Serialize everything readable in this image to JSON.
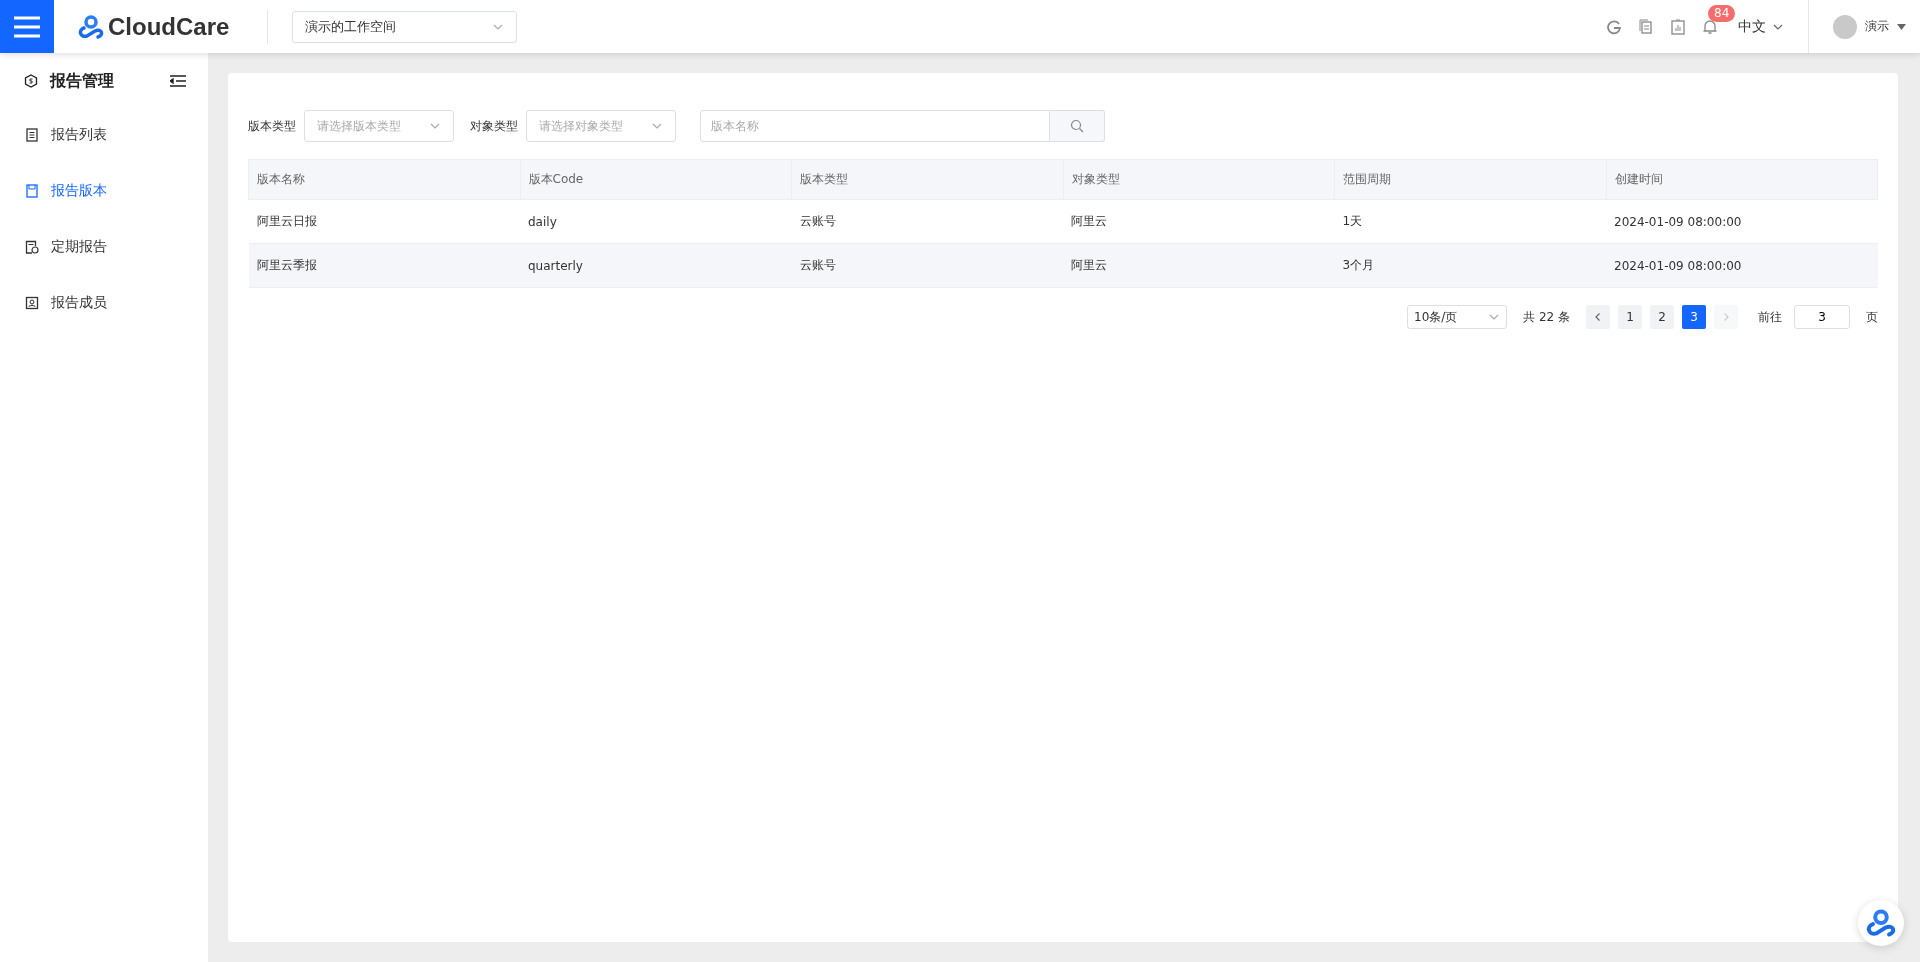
{
  "header": {
    "logo_text": "CloudCare",
    "workspace": "演示的工作空间",
    "notification_count": "84",
    "language": "中文",
    "user": "演示"
  },
  "sidebar": {
    "title": "报告管理",
    "items": [
      {
        "label": "报告列表",
        "selected": false
      },
      {
        "label": "报告版本",
        "selected": true
      },
      {
        "label": "定期报告",
        "selected": false
      },
      {
        "label": "报告成员",
        "selected": false
      }
    ]
  },
  "filters": [
    {
      "kind": "select",
      "label": "版本类型",
      "placeholder": "请选择版本类型"
    },
    {
      "kind": "select",
      "label": "对象类型",
      "placeholder": "请选择对象类型"
    },
    {
      "kind": "search",
      "placeholder": "版本名称"
    }
  ],
  "table": {
    "columns": [
      "版本名称",
      "版本Code",
      "版本类型",
      "对象类型",
      "范围周期",
      "创建时间"
    ],
    "rows": [
      [
        "阿里云日报",
        "daily",
        "云账号",
        "阿里云",
        "1天",
        "2024-01-09 08:00:00"
      ],
      [
        "阿里云季报",
        "quarterly",
        "云账号",
        "阿里云",
        "3个月",
        "2024-01-09 08:00:00"
      ]
    ]
  },
  "pagination": {
    "page_size": "10条/页",
    "total": "共 22 条",
    "prev_disabled": false,
    "next_disabled": true,
    "pages": [
      {
        "label": "1",
        "selected": false
      },
      {
        "label": "2",
        "selected": false
      },
      {
        "label": "3",
        "selected": true
      }
    ],
    "goto_label": "前往",
    "goto_value": "3",
    "goto_suffix": "页"
  }
}
